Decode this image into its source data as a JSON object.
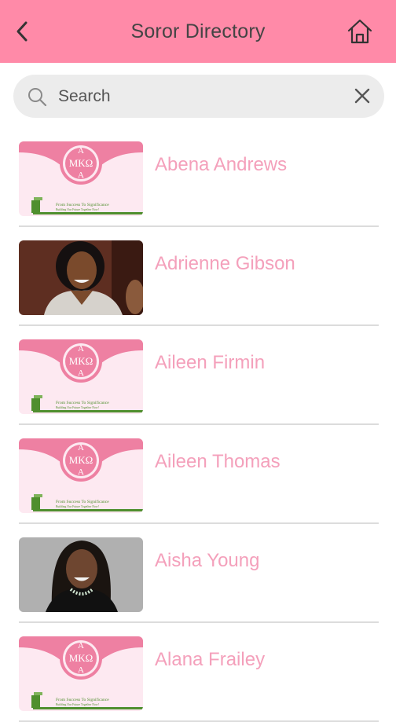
{
  "header": {
    "title": "Soror Directory",
    "back_icon": "chevron-left-icon",
    "home_icon": "home-icon"
  },
  "search": {
    "placeholder": "Search",
    "value": ""
  },
  "logo": {
    "top_letter": "A",
    "middle_letters": "ΜΚΩ",
    "bottom_letter": "A",
    "motto": "From Success To Significance",
    "tagline": "Building Our Future Together Now!"
  },
  "colors": {
    "header": "#ff8aa8",
    "name": "#f4a0bb",
    "logo_pink": "#ee80a2",
    "logo_green": "#4f8f2e"
  },
  "members": [
    {
      "name": "Abena Andrews",
      "photo": "logo"
    },
    {
      "name": "Adrienne Gibson",
      "photo": "photo"
    },
    {
      "name": "Aileen Firmin",
      "photo": "logo"
    },
    {
      "name": "Aileen Thomas",
      "photo": "logo"
    },
    {
      "name": "Aisha Young",
      "photo": "photo"
    },
    {
      "name": "Alana Frailey",
      "photo": "logo"
    }
  ]
}
